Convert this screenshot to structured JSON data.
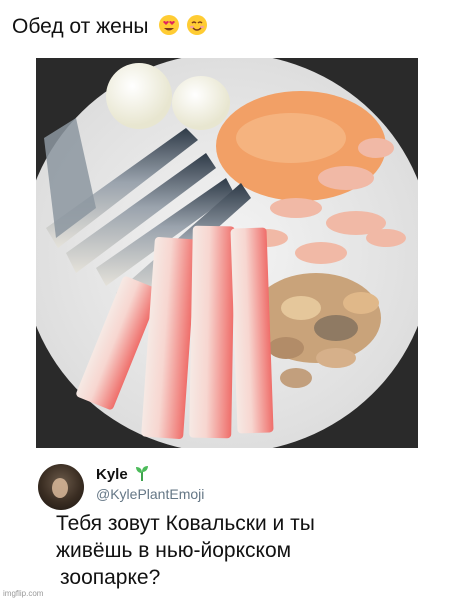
{
  "caption": {
    "text": "Обед от жены",
    "emojis": [
      "heart-eyes-emoji",
      "smiling-blush-emoji"
    ]
  },
  "photo": {
    "description_icon": "food-plate-photo"
  },
  "tweet": {
    "display_name": "Kyle",
    "name_icon": "sprout-icon",
    "handle": "@KylePlantEmoji",
    "text_lines": [
      "Тебя зовут Ковальски и ты",
      "живёшь в нью-йоркском",
      "зоопарке?"
    ]
  },
  "watermark": "imgflip.com",
  "colors": {
    "handle": "#657786",
    "plate": "#e9e9e9",
    "sauce": "#f2a066",
    "crab_stick": "#f26b6b"
  }
}
